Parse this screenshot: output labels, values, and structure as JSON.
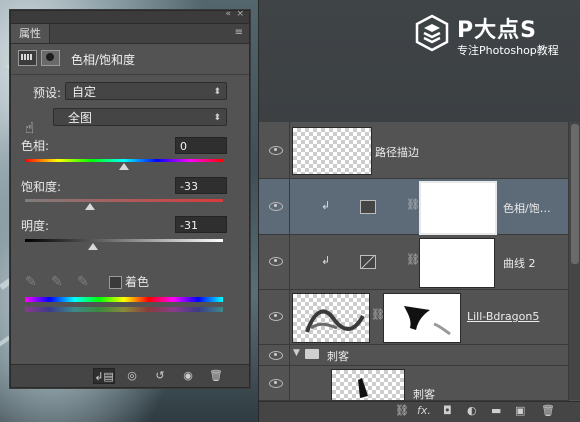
{
  "logo": {
    "title": "P大点S",
    "subtitle": "专注Photoshop教程"
  },
  "properties": {
    "tab_label": "属性",
    "collapse_glyph": "«",
    "close_glyph": "×",
    "menu_glyph": "≡",
    "title": "色相/饱和度",
    "preset_label": "预设:",
    "preset_value": "自定",
    "range_value": "全图",
    "hue_label": "色相:",
    "hue_value": "0",
    "saturation_label": "饱和度:",
    "saturation_value": "-33",
    "lightness_label": "明度:",
    "lightness_value": "-31",
    "colorize_label": "着色",
    "slider_levels": {
      "hue": 0.5,
      "saturation": 0.33,
      "lightness": 0.345
    },
    "footer_icons": [
      "clip-to-layer-icon",
      "view-previous-icon",
      "reset-icon",
      "visibility-icon",
      "trash-icon"
    ]
  },
  "layers": [
    {
      "name": "路径描边",
      "type": "normal",
      "selected": false
    },
    {
      "name": "色相/饱…",
      "type": "adjustment-hue",
      "selected": true
    },
    {
      "name": "曲线 2",
      "type": "adjustment-curves",
      "selected": false
    },
    {
      "name": "Lill-Bdragon5",
      "type": "smart-masked",
      "selected": false
    },
    {
      "name": "刺客",
      "type": "group",
      "selected": false
    },
    {
      "name": "刺客",
      "type": "normal-child",
      "selected": false
    }
  ],
  "layers_footer_icons": [
    "link-icon",
    "fx-icon",
    "add-mask-icon",
    "adjustment-icon",
    "folder-icon",
    "new-layer-icon",
    "trash-icon"
  ],
  "layers_footer_labels": {
    "fx": "fx."
  }
}
